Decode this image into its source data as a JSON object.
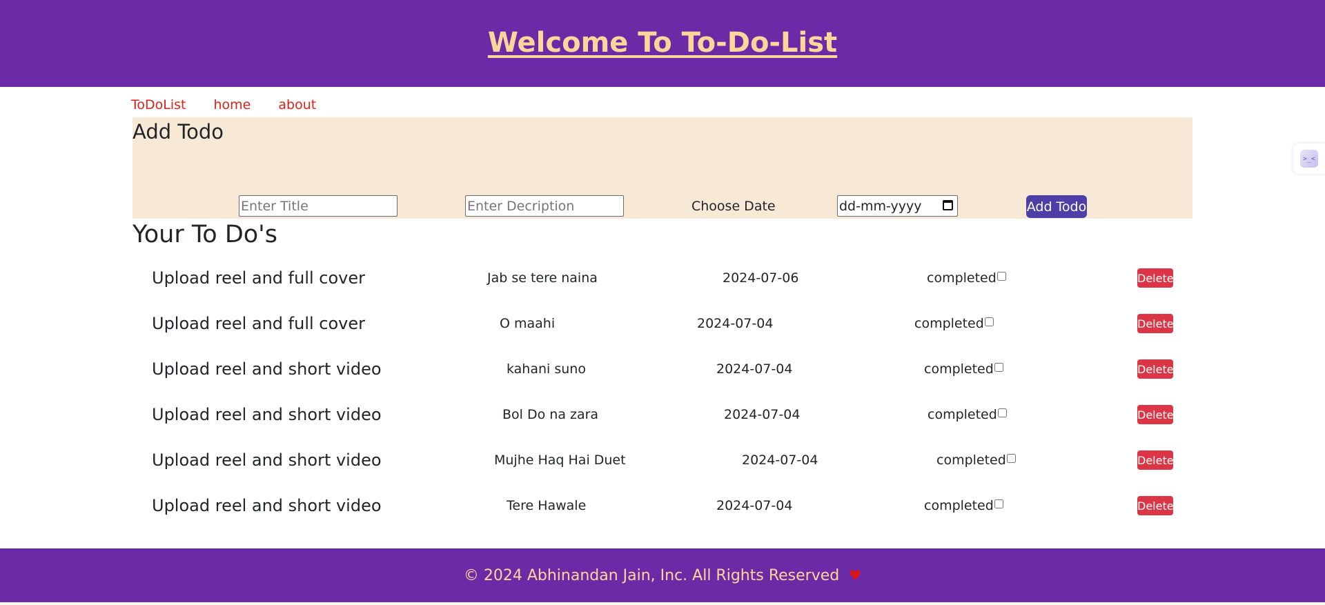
{
  "header": {
    "title": "Welcome To To-Do-List"
  },
  "nav": {
    "items": [
      "ToDoList",
      "home",
      "about"
    ]
  },
  "add_todo": {
    "heading": "Add Todo",
    "title_placeholder": "Enter Title",
    "description_placeholder": "Enter Decription",
    "date_label": "Choose Date",
    "date_placeholder": "dd-mm-yyyy",
    "add_button_label": "Add Todo"
  },
  "todos": {
    "heading": "Your To Do's",
    "completed_label": "completed",
    "delete_label": "Delete",
    "items": [
      {
        "title": "Upload reel and full cover",
        "description": "Jab se tere naina",
        "date": "2024-07-06",
        "completed": false
      },
      {
        "title": "Upload reel and full cover",
        "description": "O maahi",
        "date": "2024-07-04",
        "completed": false
      },
      {
        "title": "Upload reel and short video",
        "description": "kahani suno",
        "date": "2024-07-04",
        "completed": false
      },
      {
        "title": "Upload reel and short video",
        "description": "Bol Do na zara",
        "date": "2024-07-04",
        "completed": false
      },
      {
        "title": "Upload reel and short video",
        "description": "Mujhe Haq Hai Duet",
        "date": "2024-07-04",
        "completed": false
      },
      {
        "title": "Upload reel and short video",
        "description": "Tere Hawale",
        "date": "2024-07-04",
        "completed": false
      }
    ]
  },
  "footer": {
    "text": "© 2024 Abhinandan Jain, Inc. All Rights Reserved",
    "icon": "heart-icon"
  },
  "side_widget": {
    "icon_glyph": ">_<"
  },
  "colors": {
    "header_bg": "#6c2ba6",
    "header_text": "#ffd59a",
    "nav_link": "#e0211a",
    "panel_bg": "#f8e8d6",
    "add_button": "#4d3fa8",
    "delete_button": "#dc3545",
    "heart": "#e01414"
  }
}
